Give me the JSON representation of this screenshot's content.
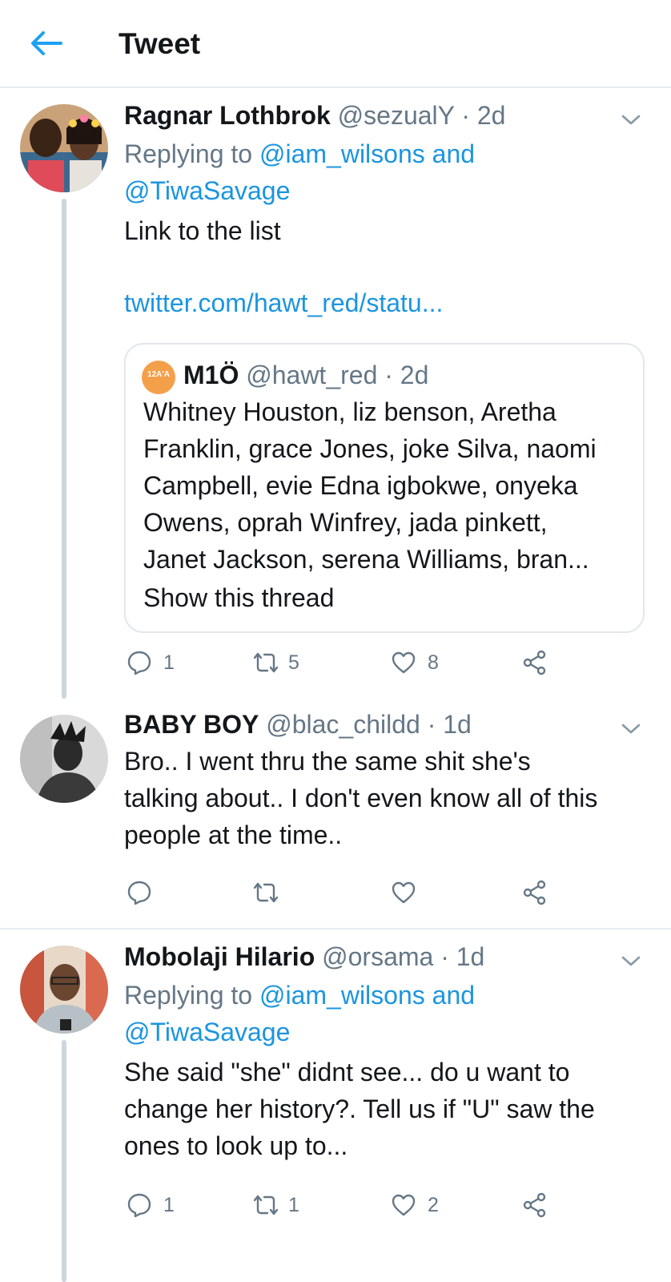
{
  "header": {
    "title": "Tweet",
    "back_icon": "arrow-left-icon",
    "accent_color": "#1da1f2"
  },
  "tweets": [
    {
      "name": "Ragnar Lothbrok",
      "handle": "@sezualY",
      "time": "2d",
      "replying_prefix": "Replying to",
      "replying_line1": "@iam_wilsons and",
      "replying_line2": "@TiwaSavage",
      "body_line1": "Link to the list",
      "link": "twitter.com/hawt_red/statu...",
      "quote": {
        "name": "M1Ö",
        "handle": "@hawt_red",
        "time": "2d",
        "avatar_text": "12A'A",
        "lines": [
          "Whitney Houston,  liz benson, Aretha",
          "Franklin, grace Jones, joke Silva, naomi",
          "Campbell, evie Edna igbokwe, onyeka",
          "Owens, oprah Winfrey, jada pinkett,",
          "Janet Jackson, serena Williams,  bran..."
        ],
        "show_thread": "Show this thread"
      },
      "reply_count": "1",
      "retweet_count": "5",
      "like_count": "8"
    },
    {
      "name": "BABY BOY",
      "handle": "@blac_childd",
      "time": "1d",
      "body_lines": [
        "Bro.. I went thru the same shit she's",
        "talking about.. I don't even know all of this",
        "people at the time.."
      ]
    },
    {
      "name": "Mobolaji Hilario",
      "handle": "@orsama",
      "time": "1d",
      "replying_prefix": "Replying to",
      "replying_line1": "@iam_wilsons and",
      "replying_line2": "@TiwaSavage",
      "body_lines": [
        "She said \"she\" didnt see... do u want to",
        "change her history?. Tell us if \"U\" saw the",
        "ones to look up to..."
      ],
      "reply_count": "1",
      "retweet_count": "1",
      "like_count": "2"
    }
  ],
  "separator": "·"
}
